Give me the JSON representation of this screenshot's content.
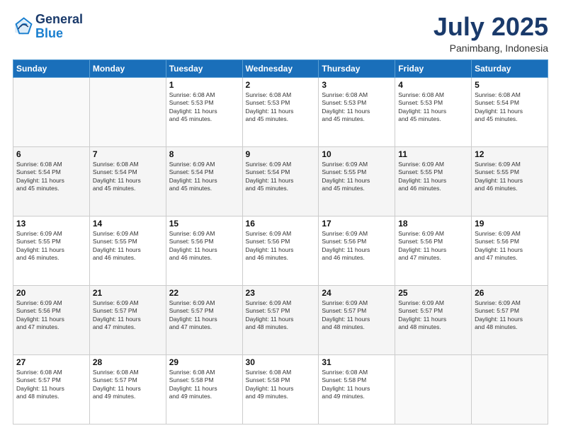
{
  "header": {
    "logo_line1": "General",
    "logo_line2": "Blue",
    "month": "July 2025",
    "location": "Panimbang, Indonesia"
  },
  "weekdays": [
    "Sunday",
    "Monday",
    "Tuesday",
    "Wednesday",
    "Thursday",
    "Friday",
    "Saturday"
  ],
  "weeks": [
    [
      {
        "day": "",
        "info": ""
      },
      {
        "day": "",
        "info": ""
      },
      {
        "day": "1",
        "info": "Sunrise: 6:08 AM\nSunset: 5:53 PM\nDaylight: 11 hours\nand 45 minutes."
      },
      {
        "day": "2",
        "info": "Sunrise: 6:08 AM\nSunset: 5:53 PM\nDaylight: 11 hours\nand 45 minutes."
      },
      {
        "day": "3",
        "info": "Sunrise: 6:08 AM\nSunset: 5:53 PM\nDaylight: 11 hours\nand 45 minutes."
      },
      {
        "day": "4",
        "info": "Sunrise: 6:08 AM\nSunset: 5:53 PM\nDaylight: 11 hours\nand 45 minutes."
      },
      {
        "day": "5",
        "info": "Sunrise: 6:08 AM\nSunset: 5:54 PM\nDaylight: 11 hours\nand 45 minutes."
      }
    ],
    [
      {
        "day": "6",
        "info": "Sunrise: 6:08 AM\nSunset: 5:54 PM\nDaylight: 11 hours\nand 45 minutes."
      },
      {
        "day": "7",
        "info": "Sunrise: 6:08 AM\nSunset: 5:54 PM\nDaylight: 11 hours\nand 45 minutes."
      },
      {
        "day": "8",
        "info": "Sunrise: 6:09 AM\nSunset: 5:54 PM\nDaylight: 11 hours\nand 45 minutes."
      },
      {
        "day": "9",
        "info": "Sunrise: 6:09 AM\nSunset: 5:54 PM\nDaylight: 11 hours\nand 45 minutes."
      },
      {
        "day": "10",
        "info": "Sunrise: 6:09 AM\nSunset: 5:55 PM\nDaylight: 11 hours\nand 45 minutes."
      },
      {
        "day": "11",
        "info": "Sunrise: 6:09 AM\nSunset: 5:55 PM\nDaylight: 11 hours\nand 46 minutes."
      },
      {
        "day": "12",
        "info": "Sunrise: 6:09 AM\nSunset: 5:55 PM\nDaylight: 11 hours\nand 46 minutes."
      }
    ],
    [
      {
        "day": "13",
        "info": "Sunrise: 6:09 AM\nSunset: 5:55 PM\nDaylight: 11 hours\nand 46 minutes."
      },
      {
        "day": "14",
        "info": "Sunrise: 6:09 AM\nSunset: 5:55 PM\nDaylight: 11 hours\nand 46 minutes."
      },
      {
        "day": "15",
        "info": "Sunrise: 6:09 AM\nSunset: 5:56 PM\nDaylight: 11 hours\nand 46 minutes."
      },
      {
        "day": "16",
        "info": "Sunrise: 6:09 AM\nSunset: 5:56 PM\nDaylight: 11 hours\nand 46 minutes."
      },
      {
        "day": "17",
        "info": "Sunrise: 6:09 AM\nSunset: 5:56 PM\nDaylight: 11 hours\nand 46 minutes."
      },
      {
        "day": "18",
        "info": "Sunrise: 6:09 AM\nSunset: 5:56 PM\nDaylight: 11 hours\nand 47 minutes."
      },
      {
        "day": "19",
        "info": "Sunrise: 6:09 AM\nSunset: 5:56 PM\nDaylight: 11 hours\nand 47 minutes."
      }
    ],
    [
      {
        "day": "20",
        "info": "Sunrise: 6:09 AM\nSunset: 5:56 PM\nDaylight: 11 hours\nand 47 minutes."
      },
      {
        "day": "21",
        "info": "Sunrise: 6:09 AM\nSunset: 5:57 PM\nDaylight: 11 hours\nand 47 minutes."
      },
      {
        "day": "22",
        "info": "Sunrise: 6:09 AM\nSunset: 5:57 PM\nDaylight: 11 hours\nand 47 minutes."
      },
      {
        "day": "23",
        "info": "Sunrise: 6:09 AM\nSunset: 5:57 PM\nDaylight: 11 hours\nand 48 minutes."
      },
      {
        "day": "24",
        "info": "Sunrise: 6:09 AM\nSunset: 5:57 PM\nDaylight: 11 hours\nand 48 minutes."
      },
      {
        "day": "25",
        "info": "Sunrise: 6:09 AM\nSunset: 5:57 PM\nDaylight: 11 hours\nand 48 minutes."
      },
      {
        "day": "26",
        "info": "Sunrise: 6:09 AM\nSunset: 5:57 PM\nDaylight: 11 hours\nand 48 minutes."
      }
    ],
    [
      {
        "day": "27",
        "info": "Sunrise: 6:08 AM\nSunset: 5:57 PM\nDaylight: 11 hours\nand 48 minutes."
      },
      {
        "day": "28",
        "info": "Sunrise: 6:08 AM\nSunset: 5:57 PM\nDaylight: 11 hours\nand 49 minutes."
      },
      {
        "day": "29",
        "info": "Sunrise: 6:08 AM\nSunset: 5:58 PM\nDaylight: 11 hours\nand 49 minutes."
      },
      {
        "day": "30",
        "info": "Sunrise: 6:08 AM\nSunset: 5:58 PM\nDaylight: 11 hours\nand 49 minutes."
      },
      {
        "day": "31",
        "info": "Sunrise: 6:08 AM\nSunset: 5:58 PM\nDaylight: 11 hours\nand 49 minutes."
      },
      {
        "day": "",
        "info": ""
      },
      {
        "day": "",
        "info": ""
      }
    ]
  ]
}
